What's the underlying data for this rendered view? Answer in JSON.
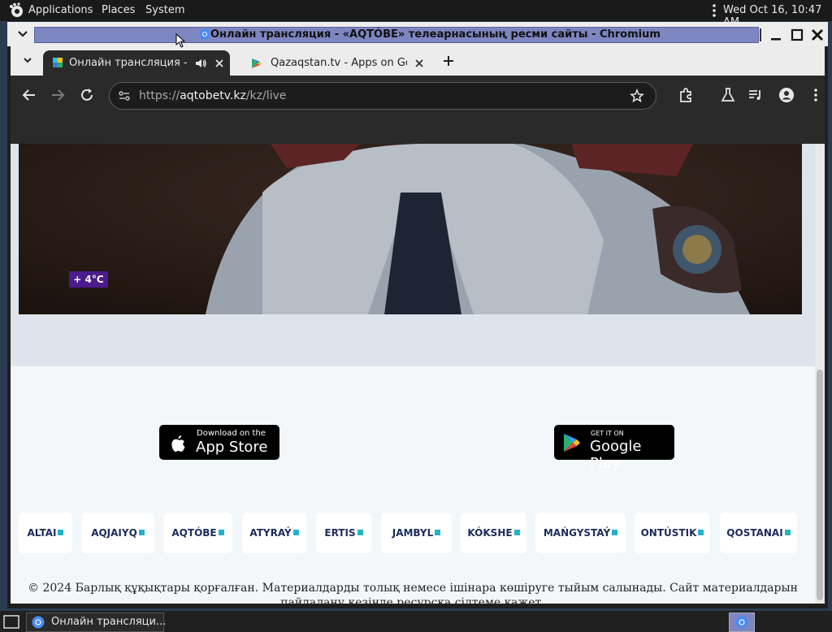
{
  "panel": {
    "applications": "Applications",
    "places": "Places",
    "system": "System",
    "clock": "Wed Oct 16, 10:47 AM"
  },
  "window": {
    "title": "Онлайн трансляция - «AQTÓBE» телеарнасының ресми сайты - Chromium"
  },
  "tabs": [
    {
      "label": "Онлайн трансляция - «А",
      "active": true,
      "icon": "aqtobe-favicon"
    },
    {
      "label": "Qazaqstan.tv - Apps on Goo",
      "active": false,
      "icon": "google-play-favicon"
    }
  ],
  "toolbar": {
    "url_scheme": "https://",
    "url_domain": "aqtobetv.kz",
    "url_path": "/kz/live"
  },
  "video": {
    "temperature": "+ 4°C"
  },
  "stores": {
    "appstore_small": "Download on the",
    "appstore_big": "App Store",
    "googleplay_small": "GET IT ON",
    "googleplay_big": "Google Play"
  },
  "regions": [
    "ALTAI",
    "AQJAIYQ",
    "AQTÓBE",
    "ATYRAÝ",
    "ERTIS",
    "JAMBYL",
    "KÓKSHE",
    "MAŃGYSTAÝ",
    "ONTÚSTIK",
    "QOSTANAI"
  ],
  "footer": {
    "copyright_line1": "© 2024 Барлық құқықтары қорғалған. Материалдарды толық немесе ішінара көшіруге тыйым салынады. Сайт материалдарын",
    "copyright_line2": "пайдалану кезінде ресурсқа сілтеме қажет."
  },
  "taskbar": {
    "item": "Онлайн трансляци..."
  },
  "colors": {
    "temp_badge": "#4b1c8c",
    "region_text": "#1c2c5a",
    "region_accent": "#22b3c9",
    "title_highlight": "#7e86c1"
  }
}
